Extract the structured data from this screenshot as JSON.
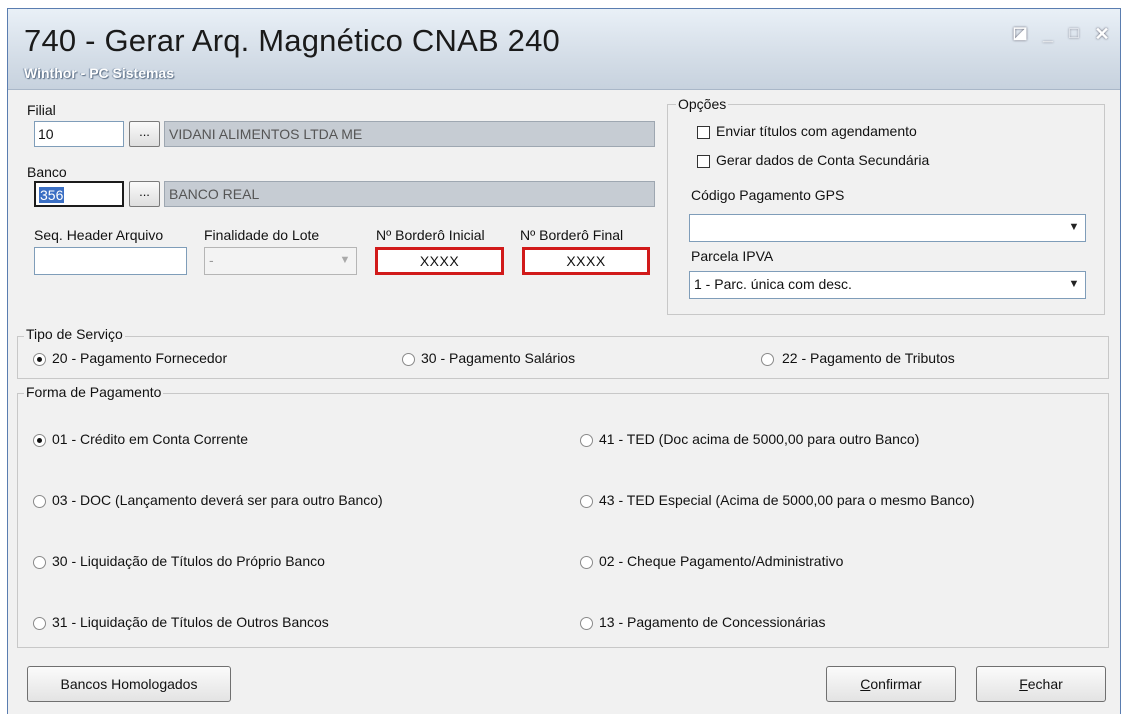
{
  "window": {
    "title": "740 - Gerar Arq. Magnético CNAB 240",
    "subtitle": "Winthor - PC Sistemas",
    "controls": {
      "restore": "◪",
      "minimize": "_",
      "maximize": "□",
      "close": "✕"
    }
  },
  "filial": {
    "label": "Filial",
    "code": "10",
    "lookup": "...",
    "name": "VIDANI ALIMENTOS LTDA ME"
  },
  "banco": {
    "label": "Banco",
    "code": "356",
    "lookup": "...",
    "name": "BANCO REAL"
  },
  "header": {
    "seq_label": "Seq. Header Arquivo",
    "seq_value": "",
    "finalidade_label": "Finalidade do Lote",
    "finalidade_value": "-",
    "bordero_inicial_label": "Nº Borderô Inicial",
    "bordero_inicial_value": "XXXX",
    "bordero_final_label": "Nº Borderô Final",
    "bordero_final_value": "XXXX"
  },
  "opcoes": {
    "legend": "Opções",
    "agendamento": "Enviar títulos com agendamento",
    "conta_secundaria": "Gerar dados de Conta Secundária",
    "gps_label": "Código Pagamento GPS",
    "gps_value": "",
    "ipva_label": "Parcela IPVA",
    "ipva_value": "1 - Parc. única com desc."
  },
  "tipo_servico": {
    "legend": "Tipo de Serviço",
    "options": [
      "20 - Pagamento Fornecedor",
      "30 - Pagamento Salários",
      "22 - Pagamento de Tributos"
    ],
    "selected": "20 - Pagamento Fornecedor"
  },
  "forma_pagamento": {
    "legend": "Forma de Pagamento",
    "options": [
      "01 - Crédito em Conta Corrente",
      "41 - TED (Doc acima de 5000,00 para outro Banco)",
      "03 - DOC (Lançamento deverá ser para outro Banco)",
      "43 - TED Especial (Acima de 5000,00 para o mesmo Banco)",
      "30 - Liquidação de Títulos do Próprio Banco",
      "02 - Cheque Pagamento/Administrativo",
      "31 - Liquidação de Títulos de Outros Bancos",
      "13 - Pagamento de Concessionárias"
    ],
    "selected": "01 - Crédito em Conta Corrente"
  },
  "buttons": {
    "bancos": "Bancos Homologados",
    "confirmar_first": "C",
    "confirmar_rest": "onfirmar",
    "fechar_first": "F",
    "fechar_rest": "echar"
  }
}
